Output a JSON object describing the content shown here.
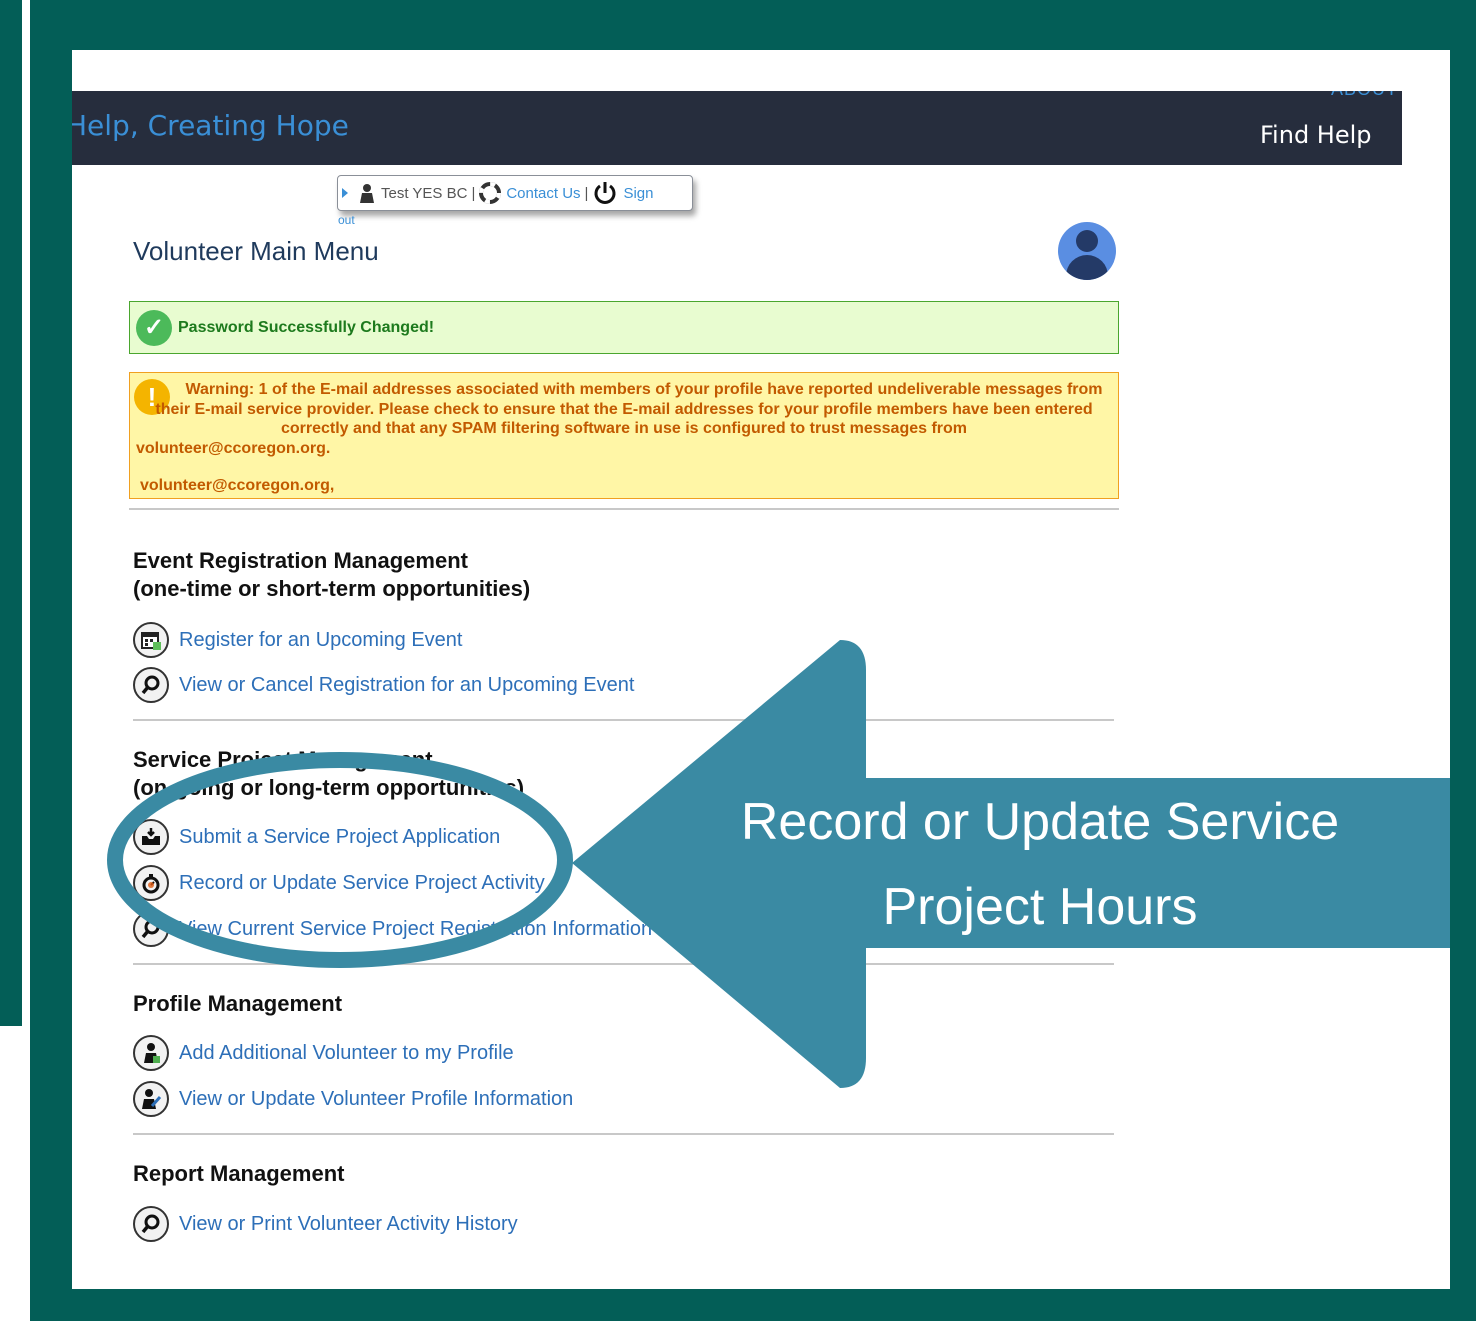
{
  "navbar": {
    "brand": "Help, Creating Hope",
    "about": "ABOUT",
    "find_help": "Find Help"
  },
  "userbar": {
    "user_name": "Test YES BC",
    "separator": "|",
    "contact_us": "Contact Us",
    "sign_out": "Sign",
    "sign_out_tail": "out"
  },
  "page": {
    "title": "Volunteer Main Menu"
  },
  "alerts": {
    "success": "Password Successfully Changed!",
    "warning_icon": "!",
    "warning_main": "Warning: 1 of the E-mail addresses associated with members of your profile have reported undeliverable messages from their E-mail service provider. Please check to ensure that the E-mail addresses for your profile members have been entered correctly and that any SPAM filtering software in use is configured to trust messages from",
    "warning_tail": "volunteer@ccoregon.org.",
    "warning_email": "volunteer@ccoregon.org,"
  },
  "sections": {
    "event": {
      "title_line1": "Event Registration Management",
      "title_line2": "(one-time or short-term opportunities)",
      "items": [
        {
          "label": "Register for an Upcoming Event",
          "icon": "calendar-icon"
        },
        {
          "label": "View or Cancel Registration for an Upcoming Event",
          "icon": "magnifier-icon"
        }
      ]
    },
    "service": {
      "title_line1": "Service Project Management",
      "title_line2": "(on-going or long-term opportunities)",
      "items": [
        {
          "label": "Submit a Service Project Application",
          "icon": "inbox-icon"
        },
        {
          "label": "Record or Update Service Project Activity",
          "icon": "stopwatch-icon"
        },
        {
          "label": "View Current Service Project Registration Information",
          "icon": "magnifier-icon"
        }
      ]
    },
    "profile": {
      "title": "Profile Management",
      "items": [
        {
          "label": "Add Additional Volunteer to my Profile",
          "icon": "person-add-icon"
        },
        {
          "label": "View or Update Volunteer Profile Information",
          "icon": "person-edit-icon"
        }
      ]
    },
    "report": {
      "title": "Report Management",
      "items": [
        {
          "label": "View or Print Volunteer Activity History",
          "icon": "magnifier-icon"
        }
      ]
    }
  },
  "callout": {
    "line1": "Record or Update Service",
    "line2": "Project Hours",
    "color": "#3a8aa3",
    "frame_color": "#035e57"
  }
}
